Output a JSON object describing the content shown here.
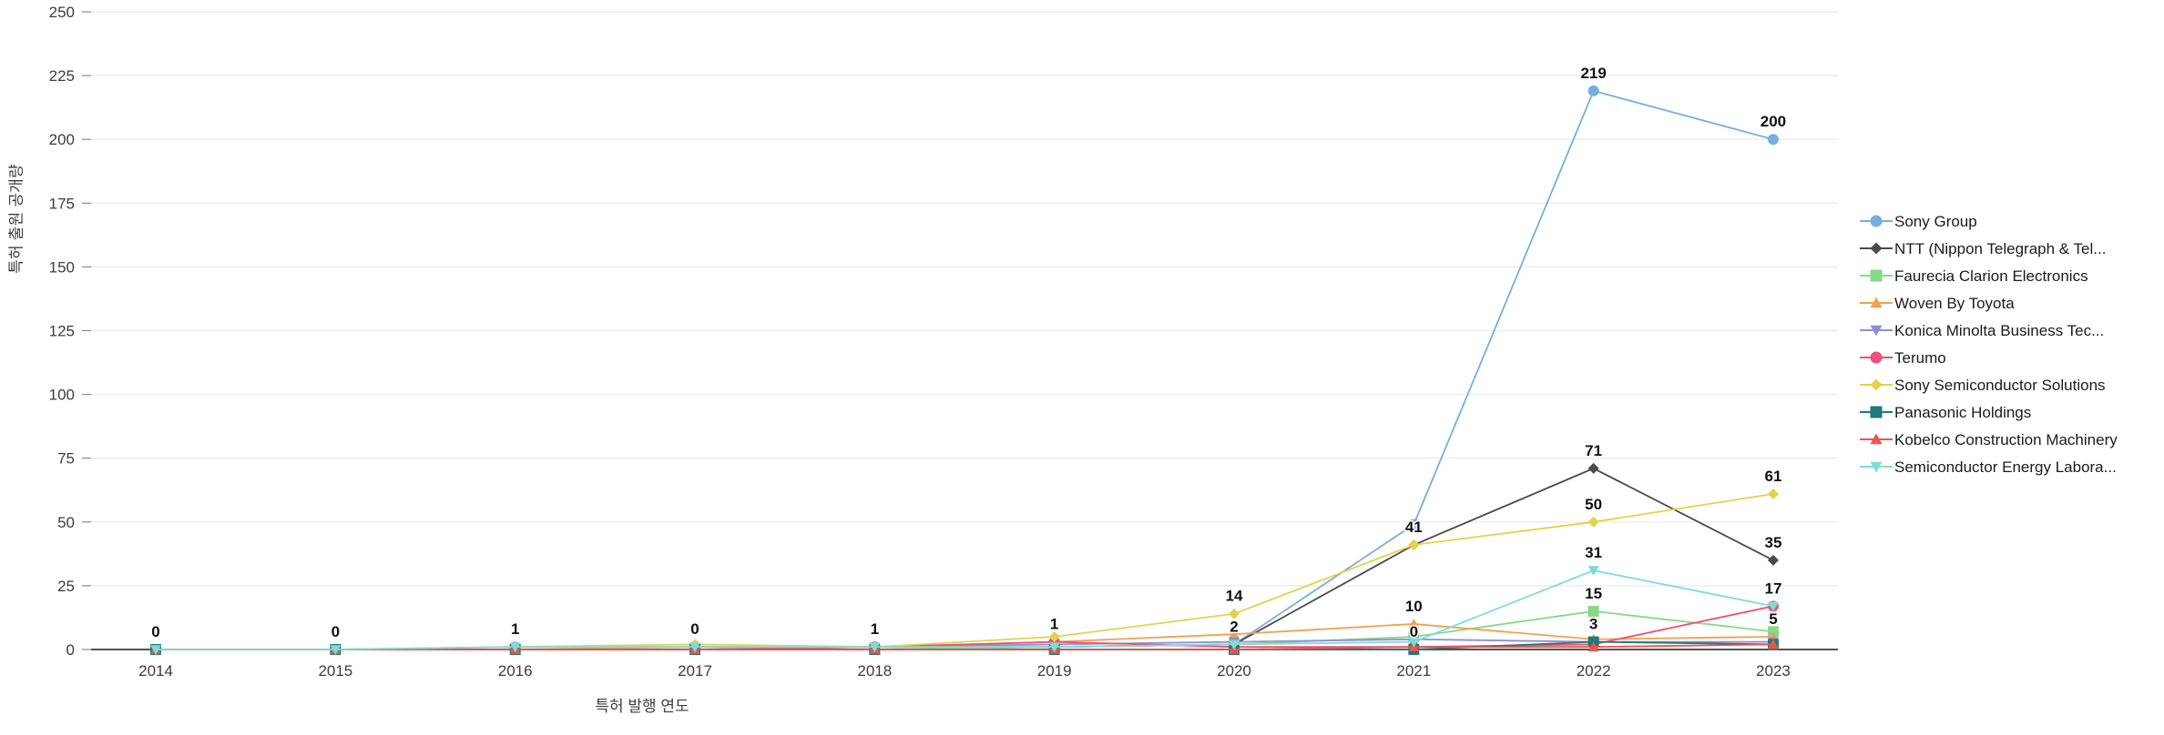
{
  "chart_data": {
    "type": "line",
    "title": "",
    "xlabel": "특허 발행 연도",
    "ylabel": "특허 출원 공개량",
    "categories": [
      "2014",
      "2015",
      "2016",
      "2017",
      "2018",
      "2019",
      "2020",
      "2021",
      "2022",
      "2023"
    ],
    "ylim": [
      0,
      250
    ],
    "yticks": [
      0,
      25,
      50,
      75,
      100,
      125,
      150,
      175,
      200,
      225,
      250
    ],
    "grid": true,
    "legend_position": "right",
    "series": [
      {
        "name": "Sony Group",
        "color": "#77ade0",
        "marker": "circle",
        "values": [
          0,
          0,
          1,
          1,
          1,
          1,
          2,
          49,
          219,
          200
        ]
      },
      {
        "name": "NTT (Nippon Telegraph & Tel...",
        "color": "#4a4a4a",
        "marker": "diamond",
        "values": [
          0,
          0,
          0,
          0,
          0,
          1,
          2,
          41,
          71,
          35
        ]
      },
      {
        "name": "Faurecia Clarion Electronics",
        "color": "#86d98a",
        "marker": "square",
        "values": [
          0,
          0,
          0,
          0,
          0,
          1,
          2,
          5,
          15,
          7
        ]
      },
      {
        "name": "Woven By Toyota",
        "color": "#f0a050",
        "marker": "triangle",
        "values": [
          0,
          0,
          0,
          1,
          1,
          3,
          6,
          10,
          4,
          5
        ]
      },
      {
        "name": "Konica Minolta Business Tec...",
        "color": "#8b8fd4",
        "marker": "triangle-down",
        "values": [
          0,
          0,
          0,
          0,
          1,
          2,
          3,
          4,
          3,
          3
        ]
      },
      {
        "name": "Terumo",
        "color": "#ee4f78",
        "marker": "circle",
        "values": [
          0,
          0,
          0,
          0,
          1,
          3,
          1,
          1,
          2,
          17
        ]
      },
      {
        "name": "Sony Semiconductor Solutions",
        "color": "#e0d44a",
        "marker": "diamond",
        "values": [
          0,
          0,
          1,
          2,
          1,
          5,
          14,
          41,
          50,
          61
        ]
      },
      {
        "name": "Panasonic Holdings",
        "color": "#1f7a7a",
        "marker": "square",
        "values": [
          0,
          0,
          0,
          0,
          0,
          0,
          0,
          0,
          3,
          2
        ]
      },
      {
        "name": "Kobelco Construction Machinery",
        "color": "#ef5350",
        "marker": "triangle",
        "values": [
          0,
          0,
          0,
          0,
          0,
          0,
          0,
          1,
          1,
          2
        ]
      },
      {
        "name": "Semiconductor Energy Labora...",
        "color": "#7fdcd4",
        "marker": "triangle-down",
        "values": [
          0,
          0,
          1,
          1,
          1,
          1,
          2,
          3,
          31,
          17
        ]
      }
    ],
    "point_labels": [
      {
        "x": "2014",
        "value": "0",
        "series": "Semiconductor Energy Labora..."
      },
      {
        "x": "2015",
        "value": "0",
        "series": "Semiconductor Energy Labora..."
      },
      {
        "x": "2016",
        "value": "1",
        "series": "Sony Group"
      },
      {
        "x": "2017",
        "value": "0",
        "series": "Semiconductor Energy Labora..."
      },
      {
        "x": "2018",
        "value": "1",
        "series": "Semiconductor Energy Labora..."
      },
      {
        "x": "2019",
        "value": "1",
        "series": "Terumo"
      },
      {
        "x": "2020",
        "value": "14",
        "series": "Sony Semiconductor Solutions"
      },
      {
        "x": "2020",
        "value": "2",
        "series": "Sony Group"
      },
      {
        "x": "2021",
        "value": "41",
        "series": "Sony Semiconductor Solutions"
      },
      {
        "x": "2021",
        "value": "10",
        "series": "Woven By Toyota"
      },
      {
        "x": "2021",
        "value": "0",
        "series": "Panasonic Holdings"
      },
      {
        "x": "2022",
        "value": "219",
        "series": "Sony Group"
      },
      {
        "x": "2022",
        "value": "71",
        "series": "NTT (Nippon Telegraph & Tel..."
      },
      {
        "x": "2022",
        "value": "50",
        "series": "Sony Semiconductor Solutions"
      },
      {
        "x": "2022",
        "value": "31",
        "series": "Semiconductor Energy Labora..."
      },
      {
        "x": "2022",
        "value": "15",
        "series": "Faurecia Clarion Electronics"
      },
      {
        "x": "2022",
        "value": "3",
        "series": "Panasonic Holdings"
      },
      {
        "x": "2023",
        "value": "200",
        "series": "Sony Group"
      },
      {
        "x": "2023",
        "value": "61",
        "series": "Sony Semiconductor Solutions"
      },
      {
        "x": "2023",
        "value": "35",
        "series": "NTT (Nippon Telegraph & Tel..."
      },
      {
        "x": "2023",
        "value": "17",
        "series": "Semiconductor Energy Labora..."
      },
      {
        "x": "2023",
        "value": "5",
        "series": "Woven By Toyota"
      }
    ]
  },
  "axes": {
    "y_title": "특허 출원 공개량",
    "x_title": "특허 발행 연도",
    "y_ticks": [
      "250",
      "225",
      "200",
      "175",
      "150",
      "125",
      "100",
      "75",
      "50",
      "25",
      "0"
    ],
    "x_ticks": [
      "2014",
      "2015",
      "2016",
      "2017",
      "2018",
      "2019",
      "2020",
      "2021",
      "2022",
      "2023"
    ]
  },
  "legend": {
    "items": [
      {
        "label": "Sony Group",
        "color": "#77ade0",
        "marker": "circle"
      },
      {
        "label": "NTT (Nippon Telegraph & Tel...",
        "color": "#4a4a4a",
        "marker": "diamond"
      },
      {
        "label": "Faurecia Clarion Electronics",
        "color": "#86d98a",
        "marker": "square"
      },
      {
        "label": "Woven By Toyota",
        "color": "#f0a050",
        "marker": "triangle"
      },
      {
        "label": "Konica Minolta Business Tec...",
        "color": "#8b8fd4",
        "marker": "triangle-down"
      },
      {
        "label": "Terumo",
        "color": "#ee4f78",
        "marker": "circle"
      },
      {
        "label": "Sony Semiconductor Solutions",
        "color": "#e0d44a",
        "marker": "diamond"
      },
      {
        "label": "Panasonic Holdings",
        "color": "#1f7a7a",
        "marker": "square"
      },
      {
        "label": "Kobelco Construction Machinery",
        "color": "#ef5350",
        "marker": "triangle"
      },
      {
        "label": "Semiconductor Energy Labora...",
        "color": "#7fdcd4",
        "marker": "triangle-down"
      }
    ]
  }
}
